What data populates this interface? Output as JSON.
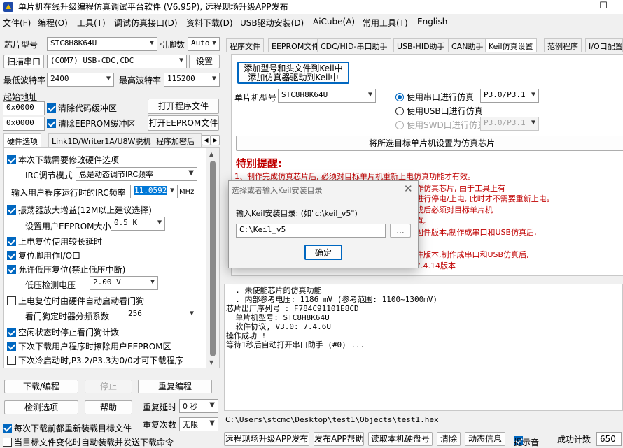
{
  "window": {
    "title": "单片机在线升级编程仿真调试平台软件 (V6.95P), 远程现场升级APP发布",
    "minimize": "—",
    "maximize": "☐"
  },
  "menu": [
    "文件(F)",
    "编程(O)",
    "工具(T)",
    "调试仿真接口(D)",
    "资料下载(D)",
    "USB驱动安装(D)",
    "AiCube(A)",
    "常用工具(T)",
    "English"
  ],
  "left": {
    "chip_label": "芯片型号",
    "chip_value": "STC8H8K64U",
    "pin_label": "引脚数",
    "pin_value": "Auto",
    "scan_button": "扫描串口",
    "port_value": "(COM7) USB-CDC,CDC",
    "settings_button": "设置",
    "min_baud_label": "最低波特率",
    "min_baud_value": "2400",
    "max_baud_label": "最高波特率",
    "max_baud_value": "115200",
    "start_addr_label": "起始地址",
    "addr1": "0x0000",
    "clear_code": "清除代码缓冲区",
    "open_program": "打开程序文件",
    "addr2": "0x0000",
    "clear_eeprom": "清除EEPROM缓冲区",
    "open_eeprom": "打开EEPROM文件",
    "tabs": [
      "硬件选项",
      "Link1D/Writer1A/U8W脱机",
      "程序加密后"
    ],
    "hw": {
      "need_modify": "本次下载需要修改硬件选项",
      "irc_mode_label": "IRC调节模式",
      "irc_mode_value": "总是动态调节IRC频率",
      "irc_freq_label": "输入用户程序运行时的IRC频率",
      "irc_freq_value": "11.0592",
      "irc_freq_unit": "MHz",
      "osc_gain": "振荡器放大增益(12M以上建议选择)",
      "eeprom_size_label": "设置用户EEPROM大小",
      "eeprom_size_value": "0.5 K",
      "reset_long": "上电复位使用较长延时",
      "reset_pin": "复位脚用作I/O口",
      "lvd_reset": "允许低压复位(禁止低压中断)",
      "lvd_label": "低压检测电压",
      "lvd_value": "2.00 V",
      "wdt_boot": "上电复位时由硬件自动启动看门狗",
      "wdt_div_label": "看门狗定时器分频系数",
      "wdt_div_value": "256",
      "idle_stop_wdt": "空闲状态时停止看门狗计数",
      "erase_eeprom": "下次下载用户程序时擦除用户EEPROM区",
      "cold_boot": "下次冷启动时,P3.2/P3.3为0/0才可下载程序"
    },
    "download_button": "下载/编程",
    "stop_button": "停止",
    "reprogram_button": "重复编程",
    "check_button": "检测选项",
    "help_button": "帮助",
    "repeat_delay_label": "重复延时",
    "repeat_delay_value": "0 秒",
    "repeat_count_label": "重复次数",
    "repeat_count_value": "无限",
    "reload_before": "每次下载前都重新装载目标文件",
    "auto_load": "当目标文件变化时自动装载并发送下载命令"
  },
  "right": {
    "tabs": [
      "程序文件",
      "EEPROM文件",
      "CDC/HID-串口助手",
      "USB-HID助手",
      "CAN助手",
      "Keil仿真设置",
      "范例程序",
      "I/O口配置"
    ],
    "add_keil_line1": "添加型号和头文件到Keil中",
    "add_keil_line2": "添加仿真器驱动到Keil中",
    "chip_label": "单片机型号",
    "chip_value": "STC8H8K64U",
    "radio_serial": "使用串口进行仿真",
    "radio_serial_pins": "P3.0/P3.1",
    "radio_usb": "使用USB口进行仿真",
    "radio_swd": "使用SWD口进行仿真",
    "radio_swd_pins": "P3.0/P3.1",
    "set_sim_chip": "将所选目标单片机设置为仿真芯片",
    "notice_title": "特别提醒:",
    "notice_lines": [
      "1、制作完成仿真芯片后, 必须对目标单片机重新上电仿真功能才有效。",
      "作仿真芯片, 由于工具上有",
      "进行停电/上电, 此时才不需要重新上电。",
      "成后必须对目标单片机",
      "真。",
      "固件版本,制作成串口和USB仿真后,",
      "件版本,制作成串口和USB仿真后,",
      "7.4.14版本"
    ],
    "log_lines": [
      "  . 未使能芯片的仿真功能",
      "  . 内部参考电压: 1186 mV (参考范围: 1100~1300mV)",
      "芯片出厂序列号 : F784C91101E8CD",
      "",
      "  单片机型号: STC8H8K64U",
      "  软件协议, V3.0: 7.4.6U",
      "",
      "操作成功 !",
      "",
      "等待1秒后自动打开串口助手 (#0) ..."
    ],
    "path_value": "C:\\Users\\stcmc\\Desktop\\test1\\Objects\\test1.hex"
  },
  "dialog": {
    "title": "选择或者输入Keil安装目录",
    "prompt": "输入Keil安装目录: (如\"c:\\keil_v5\")",
    "path_value": "C:\\Keil_v5",
    "browse": "...",
    "ok": "确定"
  },
  "status": {
    "remote_publish": "远程现场升级APP发布",
    "publish_help": "发布APP帮助",
    "read_disk": "读取本机硬盘号",
    "clear": "清除",
    "dynamic_info": "动态信息",
    "beep": "提示音",
    "success_count_label": "成功计数",
    "success_count_value": "650"
  }
}
